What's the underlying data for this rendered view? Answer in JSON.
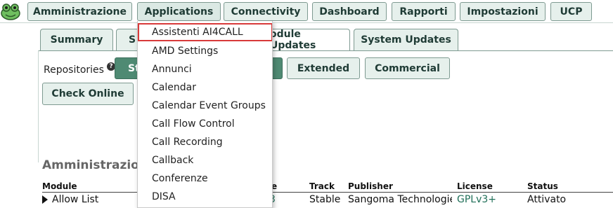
{
  "topnav": [
    "Amministrazione",
    "Applications",
    "Connectivity",
    "Dashboard",
    "Rapporti",
    "Impostazioni",
    "UCP"
  ],
  "tabs": {
    "summary": "Summary",
    "partial_left": "S",
    "module_updates_partial": "odule Updates",
    "system_updates": "System Updates"
  },
  "repositories": {
    "label": "Repositories",
    "help": "?",
    "standard_partial": "St",
    "extended": "Extended",
    "commercial": "Commercial",
    "check_online": "Check Online"
  },
  "section": {
    "title_partial": "Amministrazione"
  },
  "table": {
    "headers": {
      "module": "Module",
      "version_partial": "e",
      "track": "Track",
      "publisher": "Publisher",
      "license": "License",
      "status": "Status"
    },
    "row": {
      "module": "Allow List",
      "version_partial": "3",
      "track": "Stable",
      "publisher": "Sangoma Technologies",
      "license": "GPLv3+",
      "status": "Attivato"
    }
  },
  "dropdown": {
    "items": [
      "Assistenti AI4CALL",
      "AMD Settings",
      "Annunci",
      "Calendar",
      "Calendar Event Groups",
      "Call Flow Control",
      "Call Recording",
      "Callback",
      "Conferenze",
      "DISA"
    ]
  },
  "colors": {
    "accent_green": "#4f8a73",
    "button_bg": "#e6f0ec",
    "highlight_red": "#d83a3a"
  }
}
